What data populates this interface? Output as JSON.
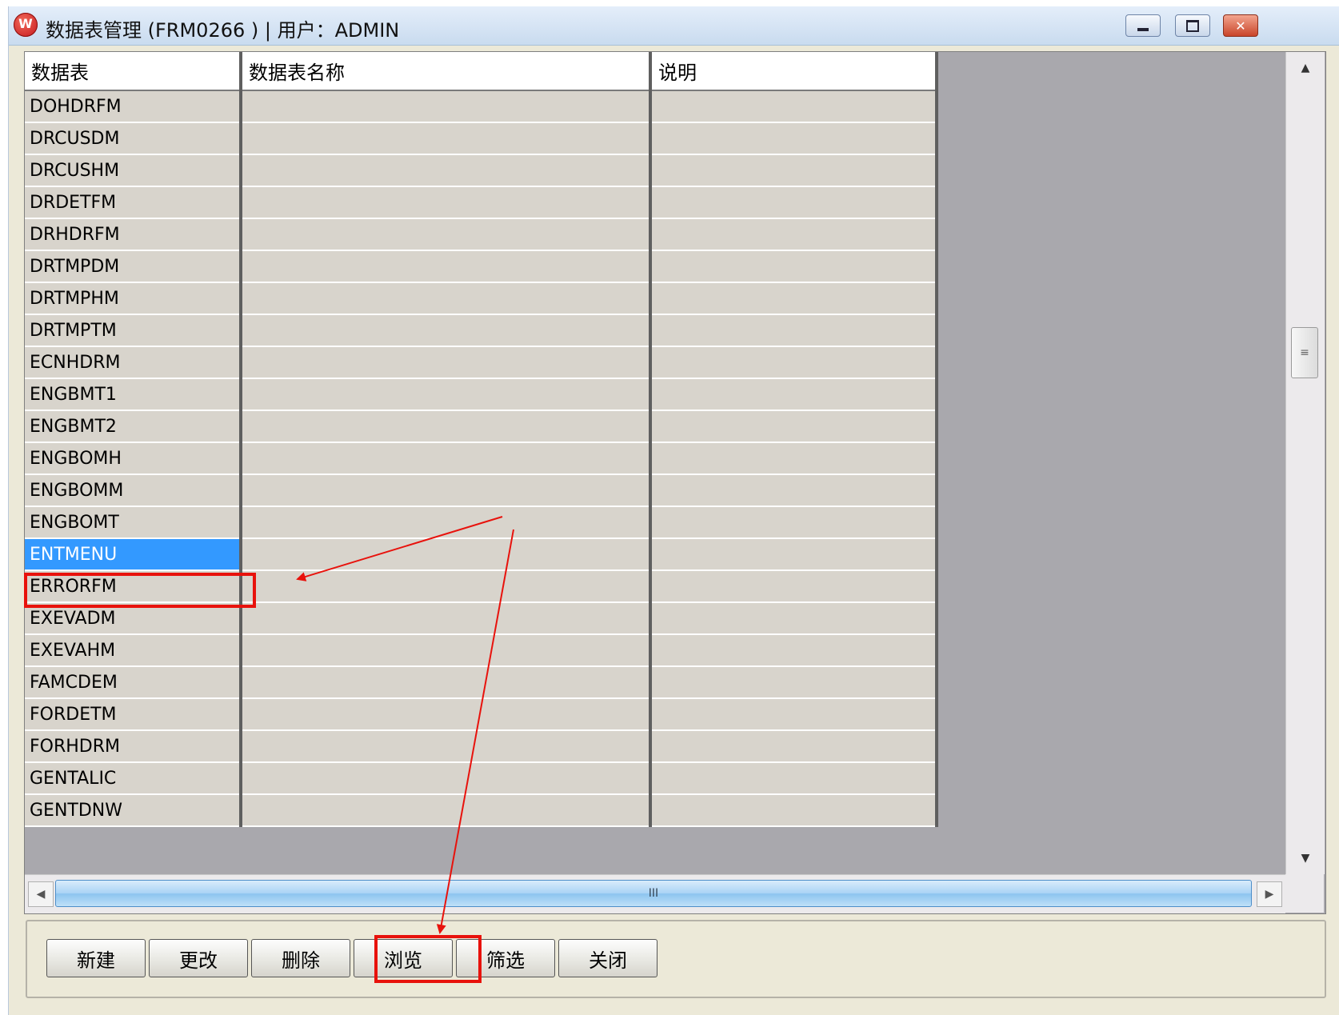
{
  "window": {
    "title": "数据表管理 (FRM0266 ) | 用户：ADMIN",
    "app_icon_glyph": "W",
    "controls": {
      "minimize": "minimize",
      "maximize": "maximize",
      "close_glyph": "✕"
    }
  },
  "grid": {
    "columns": [
      "数据表",
      "数据表名称",
      "说明"
    ],
    "rows": [
      {
        "table": "DOHDRFM",
        "name": "",
        "desc": ""
      },
      {
        "table": "DRCUSDM",
        "name": "",
        "desc": ""
      },
      {
        "table": "DRCUSHM",
        "name": "",
        "desc": ""
      },
      {
        "table": "DRDETFM",
        "name": "",
        "desc": ""
      },
      {
        "table": "DRHDRFM",
        "name": "",
        "desc": ""
      },
      {
        "table": "DRTMPDM",
        "name": "",
        "desc": ""
      },
      {
        "table": "DRTMPHM",
        "name": "",
        "desc": ""
      },
      {
        "table": "DRTMPTM",
        "name": "",
        "desc": ""
      },
      {
        "table": "ECNHDRM",
        "name": "",
        "desc": ""
      },
      {
        "table": "ENGBMT1",
        "name": "",
        "desc": ""
      },
      {
        "table": "ENGBMT2",
        "name": "",
        "desc": ""
      },
      {
        "table": "ENGBOMH",
        "name": "",
        "desc": ""
      },
      {
        "table": "ENGBOMM",
        "name": "",
        "desc": ""
      },
      {
        "table": "ENGBOMT",
        "name": "",
        "desc": ""
      },
      {
        "table": "ENTMENU",
        "name": "",
        "desc": "",
        "selected": true
      },
      {
        "table": "ERRORFM",
        "name": "",
        "desc": ""
      },
      {
        "table": "EXEVADM",
        "name": "",
        "desc": ""
      },
      {
        "table": "EXEVAHM",
        "name": "",
        "desc": ""
      },
      {
        "table": "FAMCDEM",
        "name": "",
        "desc": ""
      },
      {
        "table": "FORDETM",
        "name": "",
        "desc": ""
      },
      {
        "table": "FORHDRM",
        "name": "",
        "desc": ""
      },
      {
        "table": "GENTALIC",
        "name": "",
        "desc": ""
      },
      {
        "table": "GENTDNW",
        "name": "",
        "desc": ""
      }
    ],
    "selected_table": "ENTMENU"
  },
  "scrollbars": {
    "up_arrow": "▲",
    "down_arrow": "▼",
    "left_arrow": "◀",
    "right_arrow": "▶",
    "thumb_grip_vertical": "≡",
    "thumb_grip_horizontal": "III"
  },
  "toolbar": {
    "buttons": [
      {
        "id": "new",
        "label": "新建"
      },
      {
        "id": "edit",
        "label": "更改"
      },
      {
        "id": "delete",
        "label": "删除"
      },
      {
        "id": "browse",
        "label": "浏览"
      },
      {
        "id": "filter",
        "label": "筛选"
      },
      {
        "id": "close",
        "label": "关闭"
      }
    ]
  },
  "annotations": {
    "highlight_color": "#e8120c"
  }
}
